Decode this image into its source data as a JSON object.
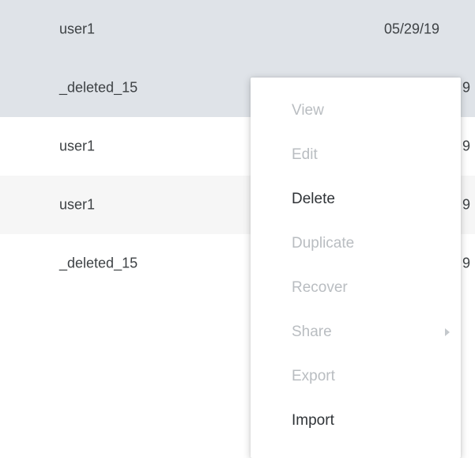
{
  "table": {
    "rows": [
      {
        "user": "user1",
        "date": "05/29/19",
        "state": "selected"
      },
      {
        "user": "_deleted_15",
        "date_tail": "9",
        "state": "selected"
      },
      {
        "user": "user1",
        "date_tail": "9",
        "state": "plain"
      },
      {
        "user": "user1",
        "date_tail": "9",
        "state": "alt"
      },
      {
        "user": "_deleted_15",
        "date_tail": "9",
        "state": "plain"
      }
    ]
  },
  "context_menu": {
    "items": [
      {
        "label": "View",
        "enabled": false
      },
      {
        "label": "Edit",
        "enabled": false
      },
      {
        "label": "Delete",
        "enabled": true
      },
      {
        "label": "Duplicate",
        "enabled": false
      },
      {
        "label": "Recover",
        "enabled": false
      },
      {
        "label": "Share",
        "enabled": false,
        "has_submenu": true
      },
      {
        "label": "Export",
        "enabled": false
      },
      {
        "label": "Import",
        "enabled": true
      }
    ]
  },
  "colors": {
    "selected_row_bg": "#dfe3e8",
    "alt_row_bg": "#f6f6f6",
    "menu_disabled_text": "#b9bdc1",
    "menu_enabled_text": "#2f3337"
  },
  "icons": {
    "share_submenu": "chevron-right-icon"
  }
}
